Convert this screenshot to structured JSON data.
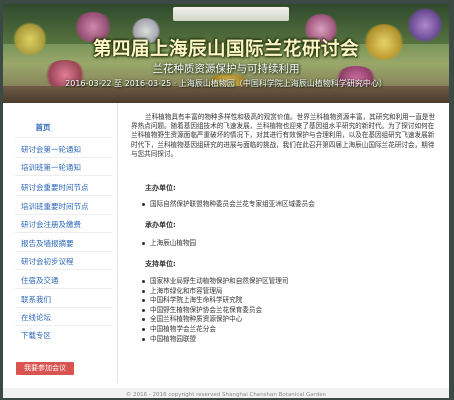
{
  "banner": {
    "title": "第四届上海辰山国际兰花研讨会",
    "subtitle": "兰花种质资源保护与可持续利用",
    "dates": "2016-03-22 至 2016-03-25 · 上海辰山植物园（中国科学院上海辰山植物科学研究中心）"
  },
  "sidebar": {
    "items": [
      {
        "label": "首页"
      },
      {
        "label": "研讨会第一轮通知"
      },
      {
        "label": "培训班第一轮通知"
      },
      {
        "label": "研讨会重要时间节点"
      },
      {
        "label": "培训班重要时间节点"
      },
      {
        "label": "研讨会注册及缴费"
      },
      {
        "label": "报告及墙报摘要"
      },
      {
        "label": "研讨会初步议程"
      },
      {
        "label": "住宿及交通"
      },
      {
        "label": "联系我们"
      },
      {
        "label": "在线论坛"
      },
      {
        "label": "下载专区"
      }
    ],
    "register_button": "我要参加会议"
  },
  "main": {
    "intro": "兰科植物具有丰富的物种多样性和极高的观赏价值。世界兰科植物资源丰富，其研究和利用一直是世界热点问题。随着基因组技术的飞速发展，兰科植物也迎来了基因组水平研究的新时代。为了探讨如何在兰科植物野生资源面临严重破坏的情况下，对其进行有效保护与合理利用，以及在基因组研究飞速发展新时代下，兰科植物基因组研究的进展与面临的挑战，我们在此召开第四届上海辰山国际兰花研讨会，期待与您共同探讨。",
    "sections": [
      {
        "heading": "主办单位:",
        "items": [
          "国际自然保护联盟物种委员会兰花专家组亚洲区域委员会"
        ]
      },
      {
        "heading": "承办单位:",
        "items": [
          "上海辰山植物园"
        ]
      },
      {
        "heading": "支持单位:",
        "items": [
          "国家林业局野生动植物保护和自然保护区管理司",
          "上海市绿化和市容管理局",
          "中国科学院上海生命科学研究院",
          "中国野生植物保护协会兰花保育委员会",
          "全国兰科植物种质资源保护中心",
          "中国植物学会兰花分会",
          "中国植物园联盟"
        ]
      }
    ]
  },
  "footer": {
    "text": "© 2016 - 2016 copyright reserved Shanghai Chenshan Botanical Garden"
  }
}
